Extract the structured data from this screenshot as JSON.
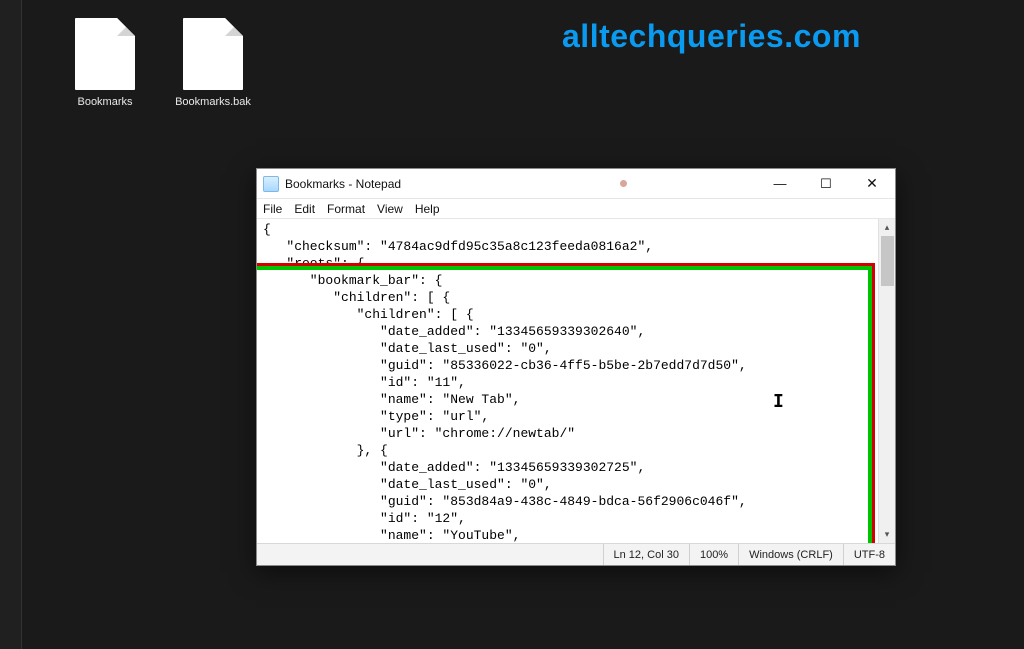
{
  "watermark": "alltechqueries.com",
  "desktop": {
    "files": [
      {
        "label": "Bookmarks"
      },
      {
        "label": "Bookmarks.bak"
      }
    ]
  },
  "notepad": {
    "title": "Bookmarks - Notepad",
    "menus": {
      "file": "File",
      "edit": "Edit",
      "format": "Format",
      "view": "View",
      "help": "Help"
    },
    "window_controls": {
      "minimize": "—",
      "maximize": "☐",
      "close": "✕"
    },
    "content": "{\n   \"checksum\": \"4784ac9dfd95c35a8c123feeda0816a2\",\n   \"roots\": {\n      \"bookmark_bar\": {\n         \"children\": [ {\n            \"children\": [ {\n               \"date_added\": \"13345659339302640\",\n               \"date_last_used\": \"0\",\n               \"guid\": \"85336022-cb36-4ff5-b5be-2b7edd7d7d50\",\n               \"id\": \"11\",\n               \"name\": \"New Tab\",\n               \"type\": \"url\",\n               \"url\": \"chrome://newtab/\"\n            }, {\n               \"date_added\": \"13345659339302725\",\n               \"date_last_used\": \"0\",\n               \"guid\": \"853d84a9-438c-4849-bdca-56f2906c046f\",\n               \"id\": \"12\",\n               \"name\": \"YouTube\",",
    "status": {
      "position": "Ln 12, Col 30",
      "zoom": "100%",
      "line_ending": "Windows (CRLF)",
      "encoding": "UTF-8"
    }
  }
}
